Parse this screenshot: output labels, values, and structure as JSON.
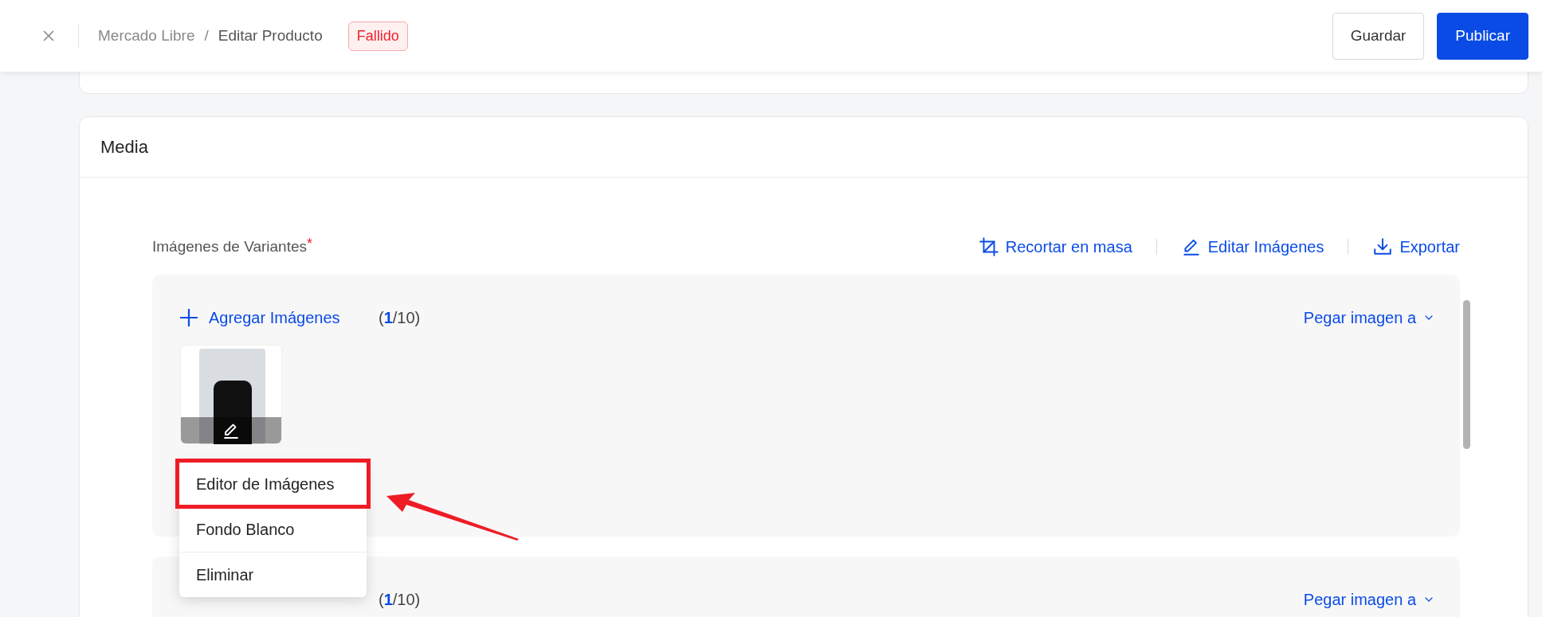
{
  "header": {
    "breadcrumb": [
      "Mercado Libre",
      "Editar Producto"
    ],
    "separator": "/",
    "status": {
      "label": "Fallido",
      "kind": "error"
    },
    "buttons": [
      {
        "label": "Guardar",
        "kind": "secondary"
      },
      {
        "label": "Publicar",
        "kind": "primary"
      }
    ]
  },
  "media": {
    "title": "Media",
    "field_label": "Imágenes de Variantes",
    "required_mark": "*",
    "actions": [
      {
        "label": "Recortar en masa",
        "kind": "crop"
      },
      {
        "label": "Editar Imágenes",
        "kind": "edit"
      },
      {
        "label": "Exportar",
        "kind": "export"
      }
    ],
    "groups": [
      {
        "add_label": "Agregar Imágenes",
        "count": "(**1**/10)",
        "paste_label": "Pegar imagen a",
        "images": [
          {
            "menu": [
              {
                "label": "Editor de Imágenes",
                "annotated": true
              },
              {
                "label": "Fondo Blanco",
                "annotated": false
              },
              {
                "label": "Eliminar",
                "annotated": false
              }
            ]
          }
        ]
      },
      {
        "count": "(**1**/10)",
        "paste_label": "Pegar imagen a"
      }
    ]
  }
}
